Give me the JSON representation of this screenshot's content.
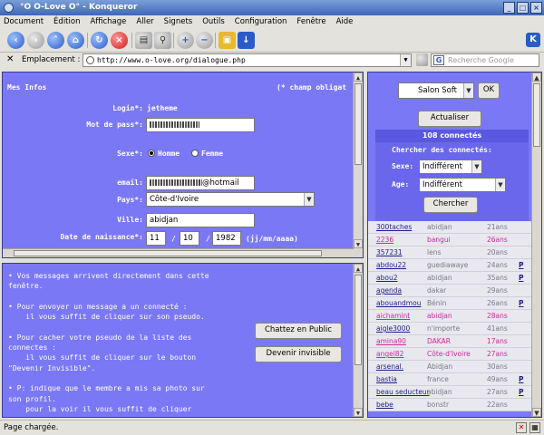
{
  "window": {
    "title": "°O O-Love O° - Konqueror"
  },
  "menu": [
    "Document",
    "Édition",
    "Affichage",
    "Aller",
    "Signets",
    "Outils",
    "Configuration",
    "Fenêtre",
    "Aide"
  ],
  "location": {
    "label": "Emplacement :",
    "url": "http://www.o-love.org/dialogue.php",
    "search_placeholder": "Recherche Google",
    "search_icon_letter": "G"
  },
  "form": {
    "heading": "Mes Infos",
    "required_note": "(* champ obligat",
    "login_label": "Login*:",
    "login_value": "jetheme",
    "password_label": "Mot de pass*:",
    "sex_label": "Sexe*:",
    "sex_options": [
      "Homme",
      "Femme"
    ],
    "sex_selected": "Homme",
    "email_label": "email:",
    "email_value": "@hotmail",
    "country_label": "Pays*:",
    "country_value": "Côte-d'Ivoire",
    "city_label": "Ville:",
    "city_value": "abidjan",
    "birth_label": "Date de naissance*:",
    "birth_day": "11",
    "birth_month": "10",
    "birth_year": "1982",
    "birth_sep": "/",
    "birth_format": "(jj/mm/aaaa)"
  },
  "messages": [
    "• Vos messages arrivent directement dans cette\nfenêtre.",
    "• Pour envoyer un message a un connecté :\n    il vous suffit de cliquer sur son pseudo.",
    "• Pour cacher votre pseudo de la liste des\nconnectes :\n    il vous suffit de cliquer sur le bouton\n\"Devenir Invisible\".",
    "• P: indique que le membre a mis sa photo sur\nson profil.\n    pour la voir il vous suffit de cliquer"
  ],
  "buttons": {
    "chat_public": "Chattez en Public",
    "invisible": "Devenir invisible",
    "ok": "OK",
    "refresh": "Actualiser",
    "search": "Chercher"
  },
  "sidebar": {
    "salon": "Salon Soft",
    "connected_count": "108 connectés",
    "search_title": "Chercher des connectés:",
    "sex_label": "Sexe:",
    "sex_value": "Indifférent",
    "age_label": "Age:",
    "age_value": "Indifférent",
    "users": [
      {
        "pseudo": "300taches",
        "city": "abidjan",
        "age": "21ans",
        "photo": "",
        "g": "m"
      },
      {
        "pseudo": "2236",
        "city": "bangui",
        "age": "26ans",
        "photo": "",
        "g": "f"
      },
      {
        "pseudo": "357231",
        "city": "lens",
        "age": "20ans",
        "photo": "",
        "g": "m"
      },
      {
        "pseudo": "abdou22",
        "city": "guediawaye",
        "age": "24ans",
        "photo": "P",
        "g": "m"
      },
      {
        "pseudo": "abou2",
        "city": "abidjan",
        "age": "35ans",
        "photo": "P",
        "g": "m"
      },
      {
        "pseudo": "agenda",
        "city": "dakar",
        "age": "29ans",
        "photo": "",
        "g": "m"
      },
      {
        "pseudo": "abouandmou",
        "city": "Bénin",
        "age": "26ans",
        "photo": "P",
        "g": "m"
      },
      {
        "pseudo": "aichamint",
        "city": "abidjan",
        "age": "28ans",
        "photo": "",
        "g": "f"
      },
      {
        "pseudo": "aigle3000",
        "city": "n'importe",
        "age": "41ans",
        "photo": "",
        "g": "m"
      },
      {
        "pseudo": "amina90",
        "city": "DAKAR",
        "age": "17ans",
        "photo": "",
        "g": "f"
      },
      {
        "pseudo": "angel82",
        "city": "Côte-d'Ivoire",
        "age": "27ans",
        "photo": "",
        "g": "f"
      },
      {
        "pseudo": "arsenal.",
        "city": "Abidjan",
        "age": "30ans",
        "photo": "",
        "g": "m"
      },
      {
        "pseudo": "bastia",
        "city": "france",
        "age": "49ans",
        "photo": "P",
        "g": "m"
      },
      {
        "pseudo": "beau seducteur",
        "city": "abidjan",
        "age": "27ans",
        "photo": "P",
        "g": "m"
      },
      {
        "pseudo": "bebe",
        "city": "bonstr",
        "age": "22ans",
        "photo": "",
        "g": "m"
      }
    ]
  },
  "status": "Page chargée.",
  "colors": {
    "frame_bg": "#7b78f6",
    "female": "#d02a9a",
    "male": "#1d1d8a"
  }
}
